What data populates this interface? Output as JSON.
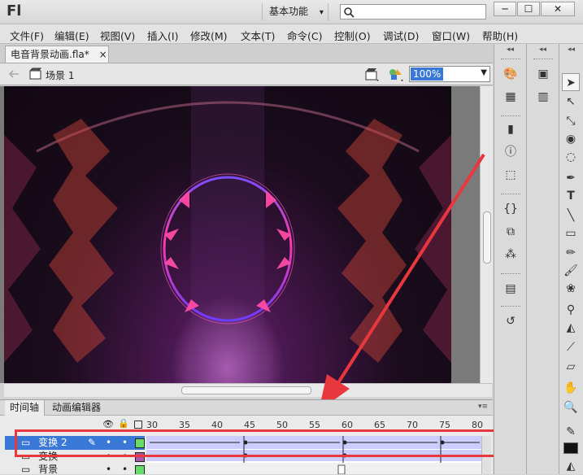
{
  "app": {
    "logo": "Fl",
    "workspace": "基本功能",
    "workspace_arrow": "▾"
  },
  "window": {
    "minimize": "─",
    "maximize": "☐",
    "close": "✕"
  },
  "menu": [
    "文件(F)",
    "编辑(E)",
    "视图(V)",
    "插入(I)",
    "修改(M)",
    "文本(T)",
    "命令(C)",
    "控制(O)",
    "调试(D)",
    "窗口(W)",
    "帮助(H)"
  ],
  "document": {
    "tab_label": "电音背景动画.fla*",
    "tab_close": "×",
    "scene": "场景 1",
    "zoom": "100%"
  },
  "timeline": {
    "tabs": [
      "时间轴",
      "动画编辑器"
    ],
    "frame_numbers": [
      "30",
      "35",
      "40",
      "45",
      "50",
      "55",
      "60",
      "65",
      "70",
      "75",
      "80"
    ],
    "layers": [
      {
        "name": "变换 2",
        "selected": true,
        "color": "#66dd66"
      },
      {
        "name": "变换",
        "selected": false,
        "color": "#aa55aa"
      },
      {
        "name": "背景",
        "selected": false,
        "color": "#66dd66"
      }
    ]
  },
  "panel_arrows": "◂◂",
  "tools_icons": [
    "selection-tool",
    "subselection-tool",
    "free-transform-tool",
    "3d-rotation-tool",
    "lasso-tool",
    "pen-tool",
    "text-tool",
    "line-tool",
    "rectangle-tool",
    "pencil-tool",
    "brush-tool",
    "deco-tool",
    "bone-tool",
    "paint-bucket-tool",
    "eyedropper-tool",
    "eraser-tool",
    "hand-tool",
    "zoom-tool"
  ],
  "colors": {
    "annotation_red": "#e8383d",
    "selection_blue": "#3a78d8",
    "keyframe_tint": "#ccccff"
  }
}
